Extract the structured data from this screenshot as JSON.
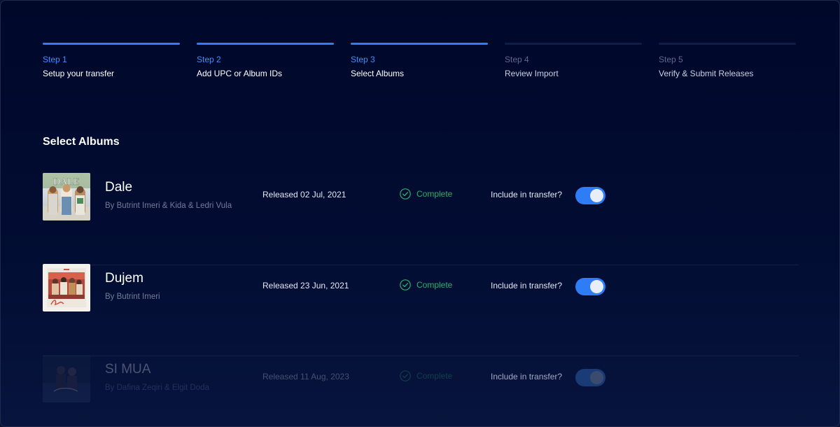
{
  "steps": [
    {
      "num": "Step 1",
      "title": "Setup your transfer",
      "done": true
    },
    {
      "num": "Step 2",
      "title": "Add UPC or Album IDs",
      "done": true
    },
    {
      "num": "Step 3",
      "title": "Select Albums",
      "done": true
    },
    {
      "num": "Step 4",
      "title": "Review Import",
      "done": false
    },
    {
      "num": "Step 5",
      "title": "Verify & Submit Releases",
      "done": false
    }
  ],
  "section_title": "Select Albums",
  "albums": [
    {
      "title": "Dale",
      "artist": "By Butrint Imeri & Kida & Ledri Vula",
      "released": "Released 02 Jul, 2021",
      "status": "Complete",
      "include_label": "Include in transfer?",
      "included": true
    },
    {
      "title": "Dujem",
      "artist": "By Butrint Imeri",
      "released": "Released 23 Jun, 2021",
      "status": "Complete",
      "include_label": "Include in transfer?",
      "included": true
    },
    {
      "title": "SI MUA",
      "artist": "By Dafina Zeqiri & Elgit Doda",
      "released": "Released 11 Aug, 2023",
      "status": "Complete",
      "include_label": "Include in transfer?",
      "included": true
    }
  ],
  "cover_art": [
    {
      "text": "DALE"
    },
    {
      "text": ""
    },
    {
      "text": ""
    }
  ],
  "colors": {
    "accent": "#2f7df6",
    "success": "#25b26a",
    "background": "#00082a"
  }
}
